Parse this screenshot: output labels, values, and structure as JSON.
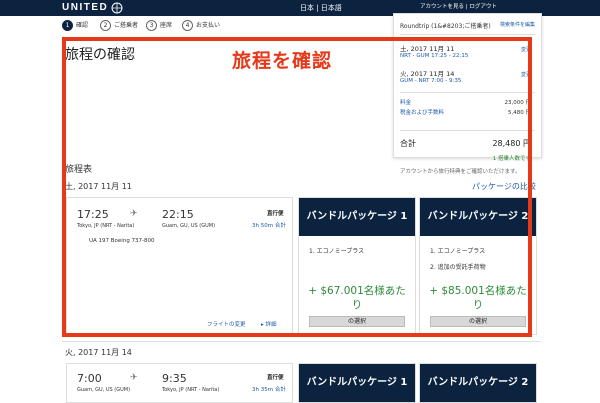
{
  "header": {
    "logo": "UNITED",
    "language": "日本 | 日本語",
    "account_link": "アカウントを見る",
    "logout": "ログアウト"
  },
  "steps": [
    {
      "num": "1",
      "label": "確認"
    },
    {
      "num": "2",
      "label": "ご搭乗者"
    },
    {
      "num": "3",
      "label": "座席"
    },
    {
      "num": "4",
      "label": "お支払い"
    }
  ],
  "page": {
    "title": "旅程の確認",
    "overlay_title": "旅程を確認",
    "itinerary_label": "旅程表",
    "rewards_note": "アカウントから旅行特典をご確認いただけます。",
    "compare_link": "パッケージの比較"
  },
  "summary": {
    "trip_type": "Roundtrip (1&#8203;ご搭乗者)",
    "edit_link": "検索条件を編集",
    "segments": [
      {
        "date": "土, 2017 11月 11",
        "route": "NRT - GUM 17:25 - 22:15",
        "change": "変更"
      },
      {
        "date": "火, 2017 11月 14",
        "route": "GUM - NRT 7:00 - 9:35",
        "change": "変更"
      }
    ],
    "fare_label": "料金",
    "fare_value": "23,000 円",
    "tax_label": "税金および手数料",
    "tax_value": "5,480 円",
    "total_label": "合計",
    "total_value": "28,480 円",
    "travelers": "1 搭乗人数です"
  },
  "outbound": {
    "date": "土, 2017 11月 11",
    "depart_time": "17:25",
    "arrive_time": "22:15",
    "depart_city": "Tokyo, JP (NRT - Narita)",
    "arrive_city": "Guam, GU, US (GUM)",
    "nonstop": "直行便",
    "duration": "3h 50m 合計",
    "flight": "UA 197    Boeing 737-800",
    "change_link": "フライトの変更",
    "detail_link": "詳細"
  },
  "inbound": {
    "date": "火, 2017 11月 14",
    "depart_time": "7:00",
    "arrive_time": "9:35",
    "depart_city": "Guam, GU, US (GUM)",
    "arrive_city": "Tokyo, JP (NRT - Narita)",
    "nonstop": "直行便",
    "duration": "3h 35m 合計"
  },
  "packages": [
    {
      "title": "バンドルパッケージ 1",
      "features": [
        "1. エコノミープラス"
      ],
      "price": "+ $67.001名様あたり",
      "select": "の選択"
    },
    {
      "title": "バンドルパッケージ 2",
      "features": [
        "1. エコノミープラス",
        "2. 追加の受託手荷物"
      ],
      "price": "+ $85.001名様あたり",
      "select": "の選択"
    }
  ],
  "colors": {
    "brand_navy": "#0c2340",
    "highlight_red": "#e53a1a",
    "link_blue": "#1e5aa8",
    "price_green": "#2e8b3a"
  }
}
